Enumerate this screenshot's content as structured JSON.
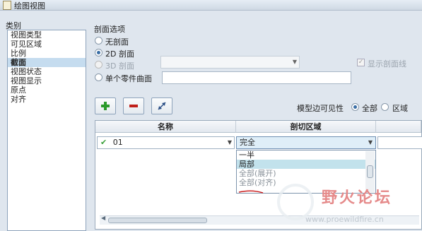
{
  "window": {
    "title": "绘图视图"
  },
  "categories": {
    "label": "类别",
    "items": [
      "视图类型",
      "可见区域",
      "比例",
      "截面",
      "视图状态",
      "视图显示",
      "原点",
      "对齐"
    ],
    "selected_index": 3
  },
  "section_options": {
    "label": "剖面选项",
    "opt_none": "无剖面",
    "opt_2d": "2D 剖面",
    "opt_3d": "3D 剖面",
    "opt_single": "单个零件曲面",
    "selected": "2D 剖面",
    "show_cutline_label": "显示剖面线",
    "show_cutline_checked": true
  },
  "toolbar": {
    "add_icon": "plus-icon",
    "remove_icon": "minus-icon",
    "flip_icon": "flip-arrow-icon"
  },
  "model_edge_visibility": {
    "label": "模型边可见性",
    "opt_all": "全部",
    "opt_area": "区域",
    "selected": "全部"
  },
  "table": {
    "headers": [
      "名称",
      "剖切区域"
    ],
    "row": {
      "name": "01",
      "name_status_icon": "check-icon",
      "region": "完全"
    }
  },
  "region_dropdown": {
    "options": [
      "一半",
      "局部",
      "全部(展开)",
      "全部(对齐)"
    ],
    "highlighted_index": 1
  },
  "watermark": {
    "text": "野火论坛",
    "url": "www.proewildfire.cn"
  },
  "colors": {
    "selection": "#c5dcef",
    "add_green": "#2a9a2a",
    "remove_red": "#c0201a",
    "watermark_red": "#e58a8a"
  }
}
